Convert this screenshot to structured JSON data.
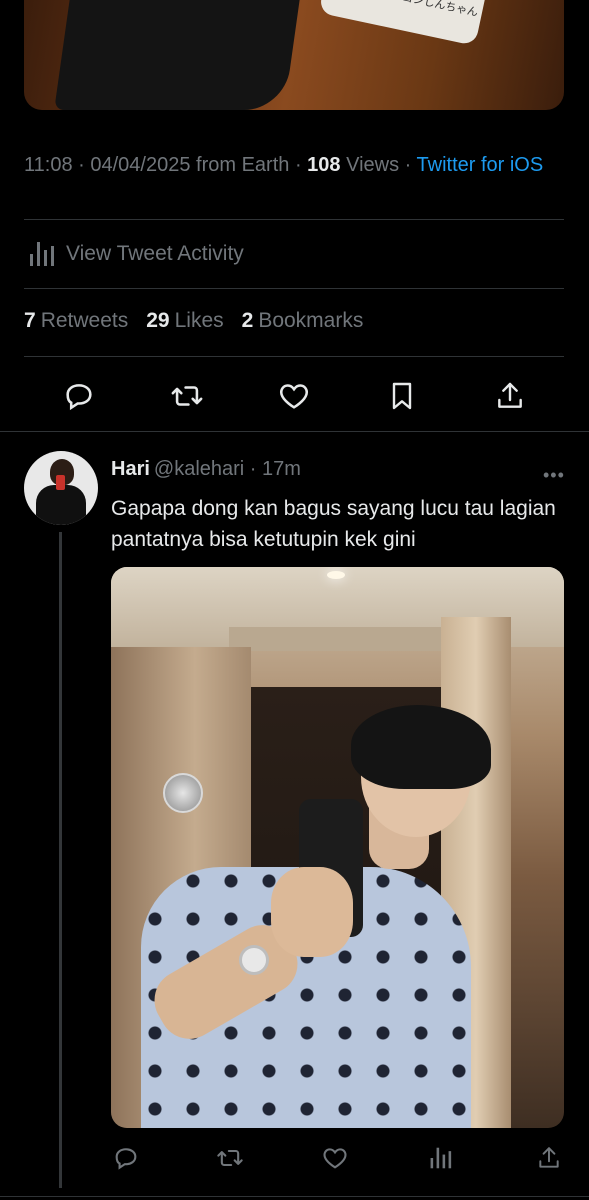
{
  "top_media": {
    "caption_jp": "クレヨンしんちゃん"
  },
  "tweet_meta": {
    "time": "11:08",
    "dot1": " · ",
    "date": "04/04/2025",
    "from": " from Earth",
    "dot2": " · ",
    "views_count": "108",
    "views_label": " Views",
    "dot3": " · ",
    "client": "Twitter for iOS"
  },
  "activity": {
    "label": "View Tweet Activity",
    "icon": "analytics-icon"
  },
  "stats": [
    {
      "count": "7",
      "label": "Retweets"
    },
    {
      "count": "29",
      "label": "Likes"
    },
    {
      "count": "2",
      "label": "Bookmarks"
    }
  ],
  "actions": [
    "reply-icon",
    "retweet-icon",
    "like-icon",
    "bookmark-icon",
    "share-icon"
  ],
  "reply": {
    "name": "Hari",
    "handle": "@kalehari",
    "dot": " · ",
    "time": "17m",
    "more": "•••",
    "text": "Gapapa dong kan bagus sayang lucu tau lagian pantatnya bisa ketutupin kek gini",
    "actions": [
      "reply-icon",
      "retweet-icon",
      "like-icon",
      "analytics-icon",
      "share-icon"
    ]
  },
  "colors": {
    "background": "#000000",
    "text": "#e7e9ea",
    "muted": "#71767b",
    "link": "#1d9bf0",
    "divider": "#2f3336"
  }
}
